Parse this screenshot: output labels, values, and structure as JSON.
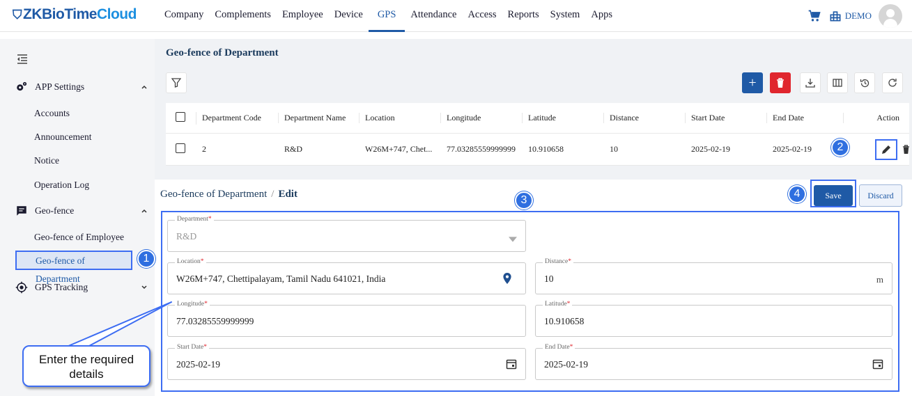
{
  "brand": {
    "shield": "⛉",
    "zk": "ZK",
    "biotime": "BioTime",
    "cloud": "Cloud"
  },
  "menu": [
    "Company",
    "Complements",
    "Employee",
    "Device",
    "GPS",
    "Attendance",
    "Access",
    "Reports",
    "System",
    "Apps"
  ],
  "active_menu": "GPS",
  "user": {
    "company": "DEMO"
  },
  "sidebar": {
    "app_settings": "APP Settings",
    "app_items": [
      "Accounts",
      "Announcement",
      "Notice",
      "Operation Log"
    ],
    "geofence": "Geo-fence",
    "geo_items": [
      "Geo-fence of Employee",
      "Geo-fence of Department"
    ],
    "gps_tracking": "GPS Tracking"
  },
  "list": {
    "title": "Geo-fence of Department",
    "columns": [
      "Department Code",
      "Department Name",
      "Location",
      "Longitude",
      "Latitude",
      "Distance",
      "Start Date",
      "End Date",
      "Action"
    ],
    "rows": [
      {
        "code": "2",
        "name": "R&D",
        "location": "W26M+747, Chet...",
        "longitude": "77.03285559999999",
        "latitude": "10.910658",
        "distance": "10",
        "start": "2025-02-19",
        "end": "2025-02-19"
      }
    ]
  },
  "edit": {
    "breadcrumb_parent": "Geo-fence of Department",
    "breadcrumb_sep": "/",
    "breadcrumb_current": "Edit",
    "save_label": "Save",
    "discard_label": "Discard",
    "fields": {
      "department": {
        "label": "Department",
        "value": "R&D"
      },
      "location": {
        "label": "Location",
        "value": "W26M+747, Chettipalayam, Tamil Nadu 641021, India"
      },
      "distance": {
        "label": "Distance",
        "value": "10",
        "unit": "m"
      },
      "longitude": {
        "label": "Longitude",
        "value": "77.03285559999999"
      },
      "latitude": {
        "label": "Latitude",
        "value": "10.910658"
      },
      "start_date": {
        "label": "Start Date",
        "value": "2025-02-19"
      },
      "end_date": {
        "label": "End Date",
        "value": "2025-02-19"
      }
    },
    "required_mark": "*"
  },
  "annotations": {
    "steps": [
      "1",
      "2",
      "3",
      "4"
    ],
    "callout": "Enter the required details"
  },
  "colors": {
    "primary": "#1f5aa6",
    "danger": "#e0262e",
    "highlight": "#3d6df2",
    "badge": "#2f6fe0"
  }
}
